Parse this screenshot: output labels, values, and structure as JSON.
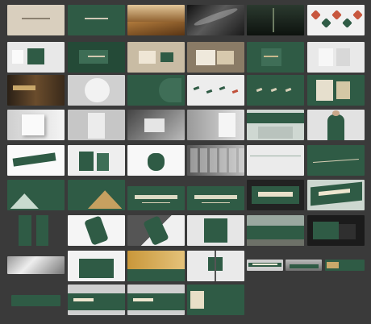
{
  "board": {
    "background": "#3a3a3a",
    "colors": {
      "green": "#2f5b45",
      "dark_green": "#244a37",
      "beige": "#d9cfbe",
      "white": "#f1f1f1",
      "grey": "#9c9c9c",
      "dark": "#1f1f1f",
      "gold": "#a07a3a"
    },
    "tiles": [
      {
        "name": "cover-beige-logo",
        "kind": "beige-logo"
      },
      {
        "name": "cover-green-logo",
        "kind": "green-logo"
      },
      {
        "name": "golden-mountain-photo",
        "kind": "gold-landscape"
      },
      {
        "name": "ink-brush-photo",
        "kind": "ink"
      },
      {
        "name": "night-street-photo",
        "kind": "night"
      },
      {
        "name": "ornament-pattern-sheet",
        "kind": "ornaments"
      },
      {
        "name": "logo-card-mockup",
        "kind": "card-light"
      },
      {
        "name": "envelope-mockup",
        "kind": "green-envelope"
      },
      {
        "name": "beige-stationery-mockup",
        "kind": "beige-objects"
      },
      {
        "name": "box-packaging-mockup",
        "kind": "green-boxes"
      },
      {
        "name": "green-folder-mockup",
        "kind": "green-folder"
      },
      {
        "name": "paper-bag-mockup",
        "kind": "light-bags"
      },
      {
        "name": "wood-wall-sign-photo",
        "kind": "brown-wall"
      },
      {
        "name": "round-plate-mockup",
        "kind": "plate"
      },
      {
        "name": "green-pattern-panel",
        "kind": "green-pattern"
      },
      {
        "name": "bird-icons-sheet",
        "kind": "birds"
      },
      {
        "name": "bird-icons-green",
        "kind": "birds-green"
      },
      {
        "name": "book-cover-mockup",
        "kind": "books"
      },
      {
        "name": "white-box-mockup",
        "kind": "white-box"
      },
      {
        "name": "doorway-mockup",
        "kind": "doorway"
      },
      {
        "name": "gray-box-mockup",
        "kind": "gray-box"
      },
      {
        "name": "gray-panel-mockup",
        "kind": "gray-panel"
      },
      {
        "name": "green-awning-photo",
        "kind": "awning"
      },
      {
        "name": "staff-uniform-photo",
        "kind": "uniform"
      },
      {
        "name": "ticket-mockup",
        "kind": "tickets"
      },
      {
        "name": "shopping-bags-mockup",
        "kind": "bags-green"
      },
      {
        "name": "drawstring-pouch-mockup",
        "kind": "pouch"
      },
      {
        "name": "glass-facade-photo",
        "kind": "facade"
      },
      {
        "name": "white-wall-panel",
        "kind": "white-wall"
      },
      {
        "name": "green-mountain-line",
        "kind": "green-line"
      },
      {
        "name": "green-mountain-banner-1",
        "kind": "mountain-green"
      },
      {
        "name": "green-mountain-banner-2",
        "kind": "mountain-gold"
      },
      {
        "name": "green-headline-banner-1",
        "kind": "headline"
      },
      {
        "name": "green-headline-banner-2",
        "kind": "headline"
      },
      {
        "name": "dark-screen-mockup",
        "kind": "dark-screen"
      },
      {
        "name": "green-flag-banner",
        "kind": "flag"
      },
      {
        "name": "roll-up-banner-pair",
        "kind": "rollups"
      },
      {
        "name": "phone-mockup-light",
        "kind": "phone-light"
      },
      {
        "name": "phone-mockup-diagonal",
        "kind": "phone-diag"
      },
      {
        "name": "gate-sign-mockup",
        "kind": "gate"
      },
      {
        "name": "construction-fence-photo",
        "kind": "fence"
      },
      {
        "name": "green-card-dark-mockup",
        "kind": "card-dark"
      },
      {
        "name": "metal-texture-photo",
        "kind": "metal"
      },
      {
        "name": "green-tote-mockup",
        "kind": "tote"
      },
      {
        "name": "gold-billboard-strip",
        "kind": "gold-strip"
      },
      {
        "name": "lamp-pole-banner",
        "kind": "lamp-banner"
      },
      {
        "name": "outdoor-billboard",
        "kind": "billboard"
      },
      {
        "name": "building-billboard",
        "kind": "building"
      },
      {
        "name": "small-banner-1",
        "kind": "small-green"
      },
      {
        "name": "small-banner-2",
        "kind": "small-green"
      },
      {
        "name": "small-banner-3",
        "kind": "small-green"
      },
      {
        "name": "street-hoarding-1",
        "kind": "street"
      },
      {
        "name": "street-hoarding-2",
        "kind": "street"
      },
      {
        "name": "street-hoarding-3",
        "kind": "street"
      },
      {
        "name": "long-banner-left",
        "kind": "long-left"
      },
      {
        "name": "long-banner-1",
        "kind": "long-green"
      },
      {
        "name": "long-banner-2",
        "kind": "long-green"
      },
      {
        "name": "long-banner-3",
        "kind": "long-green"
      }
    ]
  }
}
